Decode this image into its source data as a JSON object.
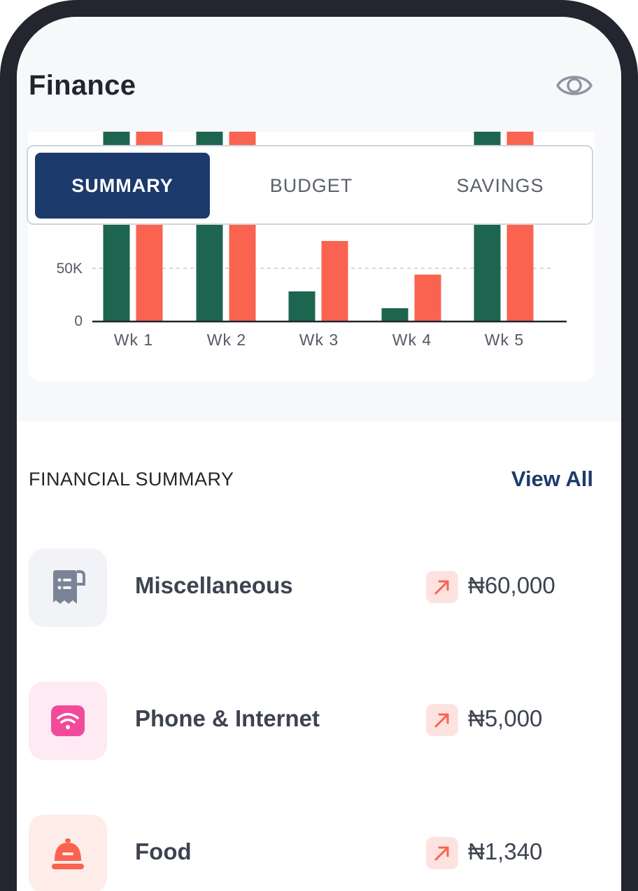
{
  "header": {
    "title": "Finance",
    "visibility_icon": "eye-icon"
  },
  "tabs": [
    {
      "label": "SUMMARY",
      "active": true
    },
    {
      "label": "BUDGET",
      "active": false
    },
    {
      "label": "SAVINGS",
      "active": false
    }
  ],
  "chart_data": {
    "type": "bar",
    "categories": [
      "Wk 1",
      "Wk 2",
      "Wk 3",
      "Wk 4",
      "Wk 5"
    ],
    "series": [
      {
        "color": "#1e6550",
        "values": [
          180000,
          180000,
          28000,
          12000,
          180000
        ]
      },
      {
        "color": "#f96350",
        "values": [
          180000,
          180000,
          76000,
          44000,
          180000
        ]
      }
    ],
    "y_ticks": [
      {
        "value": 0,
        "label": "0"
      },
      {
        "value": 50000,
        "label": "50K"
      }
    ],
    "ylim": [
      0,
      180000
    ],
    "grid": true
  },
  "financial_summary": {
    "heading": "FINANCIAL SUMMARY",
    "view_all_label": "View All",
    "items": [
      {
        "label": "Miscellaneous",
        "amount": "₦60,000",
        "icon": "receipt-icon",
        "trend": "arrow-up-right-icon",
        "icon_bg": "#f2f3f6",
        "icon_color": "#7b8497"
      },
      {
        "label": "Phone & Internet",
        "amount": "₦5,000",
        "icon": "wifi-icon",
        "trend": "arrow-up-right-icon",
        "icon_bg": "#fdeaf3",
        "icon_color": "#f24a9a"
      },
      {
        "label": "Food",
        "amount": "₦1,340",
        "icon": "cloche-icon",
        "trend": "arrow-up-right-icon",
        "icon_bg": "#fdece8",
        "icon_color": "#f96350"
      }
    ]
  }
}
